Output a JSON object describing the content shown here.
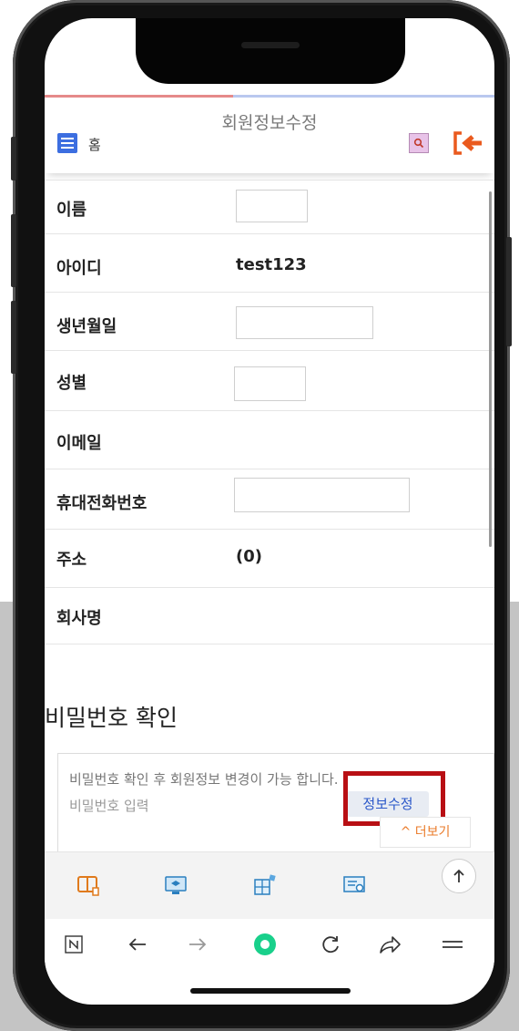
{
  "header": {
    "home_label": "홈",
    "title": "회원정보수정"
  },
  "form": {
    "rows": [
      {
        "label": "이름",
        "value": ""
      },
      {
        "label": "아이디",
        "value": "test123"
      },
      {
        "label": "생년월일",
        "value": ""
      },
      {
        "label": "성별",
        "value": ""
      },
      {
        "label": "이메일",
        "value": ""
      },
      {
        "label": "휴대전화번호",
        "value": ""
      },
      {
        "label": "주소",
        "value": "(0)"
      },
      {
        "label": "회사명",
        "value": ""
      }
    ]
  },
  "password_section": {
    "title": "비밀번호 확인",
    "notice": "비밀번호 확인 후 회원정보 변경이 가능 합니다.",
    "input_placeholder": "비밀번호 입력",
    "edit_button": "정보수정",
    "more_button": "^ 더보기"
  },
  "progress": {
    "fraction": 0.42
  },
  "colors": {
    "accent_blue": "#3c6ee0",
    "highlight_red": "#b80f14",
    "more_orange": "#ea7b2a",
    "browser_green": "#19d08b"
  },
  "dock_icons": [
    "book-icon",
    "lecture-monitor-icon",
    "puzzle-icon",
    "certificate-icon"
  ],
  "browser_bar_icons": [
    "naver-n-icon",
    "back-arrow-icon",
    "forward-arrow-icon",
    "green-circle-home-icon",
    "refresh-icon",
    "share-icon",
    "menu-lines-icon"
  ]
}
